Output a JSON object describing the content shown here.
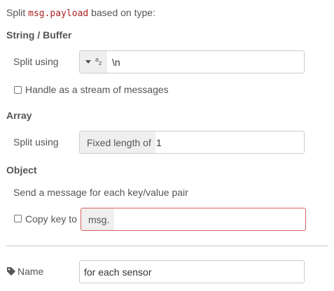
{
  "intro": {
    "prefix": "Split ",
    "code": "msg.payload",
    "suffix": " based on type:"
  },
  "string_section": {
    "title": "String / Buffer",
    "split_label": "Split using",
    "split_type_icon": "az-string-icon",
    "split_value": "\\n",
    "stream_label": "Handle as a stream of messages",
    "stream_checked": false
  },
  "array_section": {
    "title": "Array",
    "split_label": "Split using",
    "split_prefix": "Fixed length of",
    "split_value": "1"
  },
  "object_section": {
    "title": "Object",
    "description": "Send a message for each key/value pair",
    "copy_key_label": "Copy key to",
    "copy_key_checked": false,
    "copy_key_prefix": "msg.",
    "copy_key_value": ""
  },
  "name_field": {
    "label": "Name",
    "icon": "tag-icon",
    "value": "for each sensor"
  },
  "colors": {
    "code": "#aa2222",
    "error_border": "#d6615e",
    "text": "#555555"
  }
}
